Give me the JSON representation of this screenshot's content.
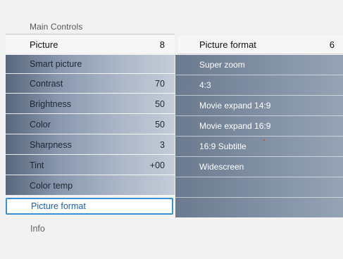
{
  "breadcrumb": "Main Controls",
  "menu_header": {
    "label": "Picture",
    "value": "8"
  },
  "left_items": [
    {
      "label": "Smart picture",
      "value": ""
    },
    {
      "label": "Contrast",
      "value": "70"
    },
    {
      "label": "Brightness",
      "value": "50"
    },
    {
      "label": "Color",
      "value": "50"
    },
    {
      "label": "Sharpness",
      "value": "3"
    },
    {
      "label": "Tint",
      "value": "+00"
    },
    {
      "label": "Color temp",
      "value": ""
    }
  ],
  "selected_item": "Picture format",
  "info_label": "Info",
  "submenu_header": {
    "label": "Picture format",
    "value": "6"
  },
  "right_items": [
    "Super zoom",
    "4:3",
    "Movie expand 14:9",
    "Movie expand 16:9",
    "16:9 Subtitle",
    "Widescreen",
    "",
    ""
  ],
  "colors": {
    "selection_border": "#3a90d5",
    "selection_text": "#1f5fa8",
    "panel_dark": "#59677c",
    "panel_light": "#c4cdd8"
  }
}
